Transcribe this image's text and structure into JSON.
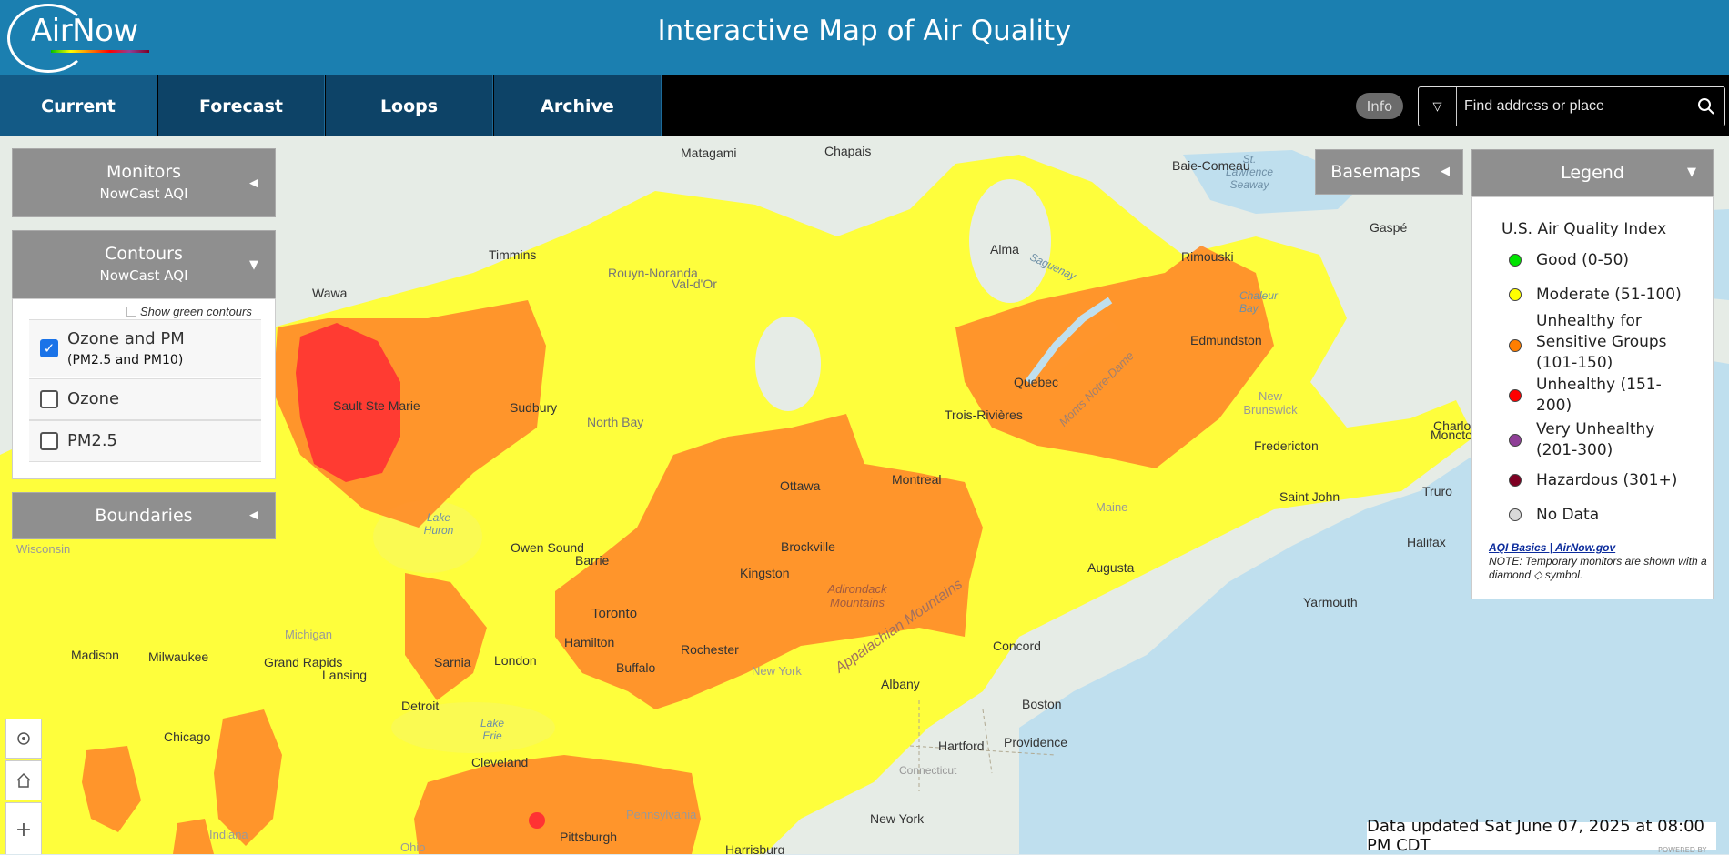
{
  "header": {
    "logo_text": "AirNow",
    "title": "Interactive Map of Air Quality"
  },
  "nav": {
    "tabs": [
      {
        "label": "Current",
        "active": true
      },
      {
        "label": "Forecast",
        "active": false
      },
      {
        "label": "Loops",
        "active": false
      },
      {
        "label": "Archive",
        "active": false
      }
    ],
    "info_label": "Info",
    "search_placeholder": "Find address or place"
  },
  "panels": {
    "monitors": {
      "title": "Monitors",
      "subtitle": "NowCast AQI"
    },
    "contours": {
      "title": "Contours",
      "subtitle": "NowCast AQI",
      "show_green": "Show green contours",
      "options": [
        {
          "label": "Ozone and PM",
          "sub": "(PM2.5 and PM10)",
          "checked": true
        },
        {
          "label": "Ozone",
          "sub": "",
          "checked": false
        },
        {
          "label": "PM2.5",
          "sub": "",
          "checked": false
        }
      ]
    },
    "boundaries": {
      "title": "Boundaries"
    },
    "basemaps": {
      "title": "Basemaps"
    },
    "legend": {
      "title": "Legend",
      "heading": "U.S. Air Quality Index",
      "items": [
        {
          "label": "Good (0-50)",
          "color": "#00e400"
        },
        {
          "label": "Moderate (51-100)",
          "color": "#ffff00"
        },
        {
          "label": "Unhealthy for Sensitive Groups (101-150)",
          "color": "#ff7e00"
        },
        {
          "label": "Unhealthy (151-200)",
          "color": "#ff0000"
        },
        {
          "label": "Very Unhealthy (201-300)",
          "color": "#8f3f97"
        },
        {
          "label": "Hazardous (301+)",
          "color": "#7e0023"
        },
        {
          "label": "No Data",
          "color": "#d9d9d9"
        }
      ],
      "link": "AQI Basics | AirNow.gov",
      "note": "NOTE: Temporary monitors are shown with a diamond ◇ symbol."
    }
  },
  "map": {
    "labels": [
      "Matagami",
      "Chapais",
      "St. Lawrence Seaway",
      "Baie-Comeau",
      "Gaspé",
      "Timmins",
      "Rouyn-Noranda",
      "Val-d'Or",
      "Alma",
      "Saguenay",
      "Rimouski",
      "Chaleur Bay",
      "Wawa",
      "Sault Ste Marie",
      "Sudbury",
      "North Bay",
      "Quebec",
      "Edmundston",
      "Trois-Rivières",
      "New Brunswick",
      "Fredericton",
      "Moncton",
      "Charlo",
      "Ottawa",
      "Montreal",
      "Saint John",
      "Truro",
      "Lake Huron",
      "Owen Sound",
      "Brockville",
      "Maine",
      "Halifax",
      "Wisconsin",
      "Barrie",
      "Kingston",
      "Adirondack Mountains",
      "Augusta",
      "Yarmouth",
      "Toronto",
      "Hamilton",
      "Michigan",
      "Rochester",
      "Madison",
      "Milwaukee",
      "Grand Rapids",
      "Sarnia",
      "London",
      "Buffalo",
      "New York",
      "Concord",
      "Lansing",
      "Albany",
      "Detroit",
      "Boston",
      "Appalachian Mountains",
      "Chicago",
      "Lake Erie",
      "Hartford",
      "Providence",
      "Cleveland",
      "Connecticut",
      "Pennsylvania",
      "New York",
      "Indiana",
      "Pittsburgh",
      "Ohio",
      "Harrisburg",
      "Monts Notre-Dame"
    ]
  },
  "tools": {
    "locate": "locate-icon",
    "home": "home-icon",
    "zoom_in": "+"
  },
  "footer": {
    "updated": "Data updated Sat June 07, 2025 at 08:00 PM CDT",
    "powered": "POWERED BY"
  },
  "colors": {
    "header": "#1b7fb0",
    "nav_tab": "#0d4367",
    "panel": "#8f8f8f"
  }
}
